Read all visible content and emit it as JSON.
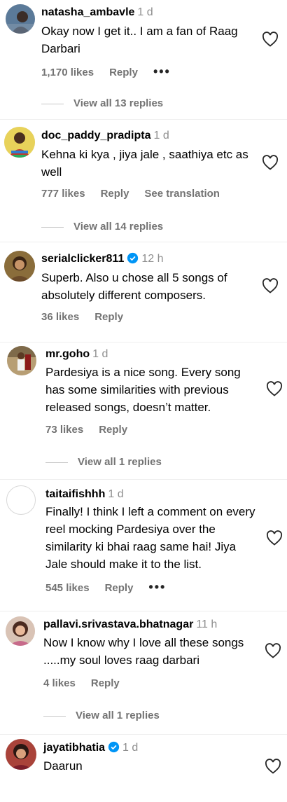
{
  "comments": [
    {
      "username": "natasha_ambavle",
      "time": "1 d",
      "text": "Okay now I get it.. I am a fan of Raag Darbari",
      "likes": "1,170 likes",
      "reply": "Reply",
      "more": "•••",
      "view_replies": "View all 13 replies"
    },
    {
      "username": "doc_paddy_pradipta",
      "time": "1 d",
      "text": "Kehna ki kya , jiya jale , saathiya etc as well",
      "likes": "777 likes",
      "reply": "Reply",
      "translation": "See translation",
      "view_replies": "View all 14 replies"
    },
    {
      "username": "serialclicker811",
      "time": "12 h",
      "verified": true,
      "text": "Superb. Also u chose all 5 songs of absolutely different composers.",
      "likes": "36 likes",
      "reply": "Reply"
    },
    {
      "username": "mr.goho",
      "time": "1 d",
      "text": "Pardesiya is a nice song. Every song has some similarities with previous released songs, doesn’t matter.",
      "likes": "73 likes",
      "reply": "Reply",
      "view_replies": "View all 1 replies"
    },
    {
      "username": "taitaifishhh",
      "time": "1 d",
      "text": "Finally! I think I left a comment on every reel mocking Pardesiya over the similarity ki bhai raag same hai! Jiya Jale should make it to the list.",
      "likes": "545 likes",
      "reply": "Reply",
      "more": "•••"
    },
    {
      "username": "pallavi.srivastava.bhatnagar",
      "time": "11 h",
      "text": "Now I know why I love all these songs .....my soul loves raag darbari",
      "likes": "4 likes",
      "reply": "Reply",
      "view_replies": "View all 1 replies"
    },
    {
      "username": "jayatibhatia",
      "time": "1 d",
      "verified": true,
      "text": "Daarun"
    }
  ],
  "colors": {
    "secondary_text": "#737373",
    "verified_blue": "#0095f6",
    "divider": "#efefef"
  },
  "icons": {
    "like": "heart-outline-icon",
    "verified": "verified-badge-icon",
    "more": "more-options-icon"
  }
}
